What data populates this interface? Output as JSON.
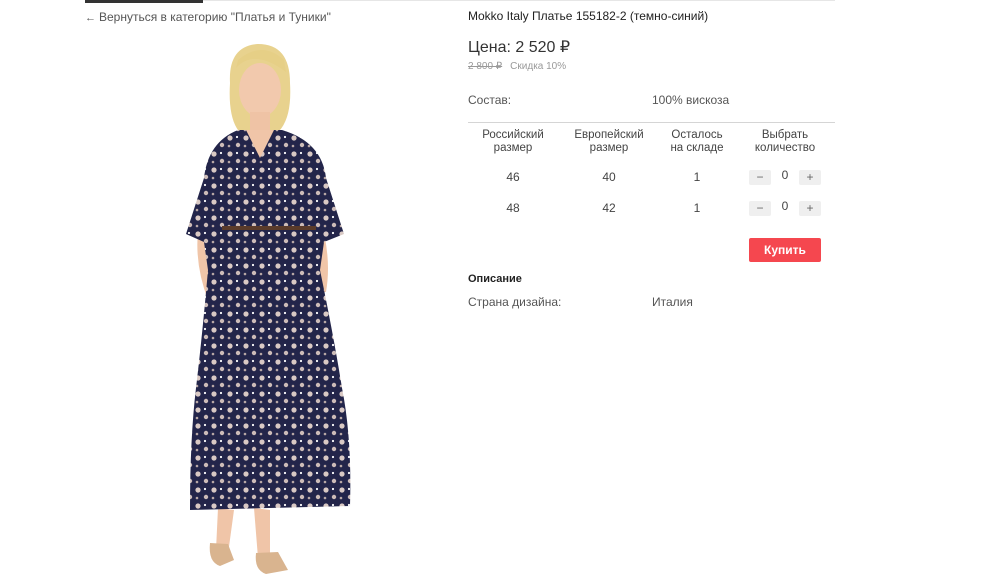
{
  "back_link": {
    "arrow": "←",
    "label": "Вернуться в категорию \"Платья и Туники\""
  },
  "product": {
    "title": "Mokko Italy Платье 155182-2 (темно-синий)",
    "price": "Цена: 2 520 ₽",
    "old_price": "2 800 ₽",
    "discount": "Скидка 10%",
    "image": "woman-in-floral-maxi-dress"
  },
  "attributes": {
    "composition_label": "Состав:",
    "composition_value": "100% вискоза"
  },
  "sizes_table": {
    "headers": [
      [
        "Российский",
        "размер"
      ],
      [
        "Европейский",
        "размер"
      ],
      [
        "Осталось",
        "на складе"
      ],
      [
        "Выбрать",
        "количество"
      ]
    ],
    "rows": [
      {
        "ru": "46",
        "eu": "40",
        "stock": "1",
        "qty": "0"
      },
      {
        "ru": "48",
        "eu": "42",
        "stock": "1",
        "qty": "0"
      }
    ],
    "minus": "−",
    "plus": "+"
  },
  "buy_label": "Купить",
  "description": {
    "heading": "Описание",
    "country_label": "Страна дизайна:",
    "country_value": "Италия"
  },
  "colors": {
    "accent": "#f5474f",
    "dress": "#23254a"
  }
}
